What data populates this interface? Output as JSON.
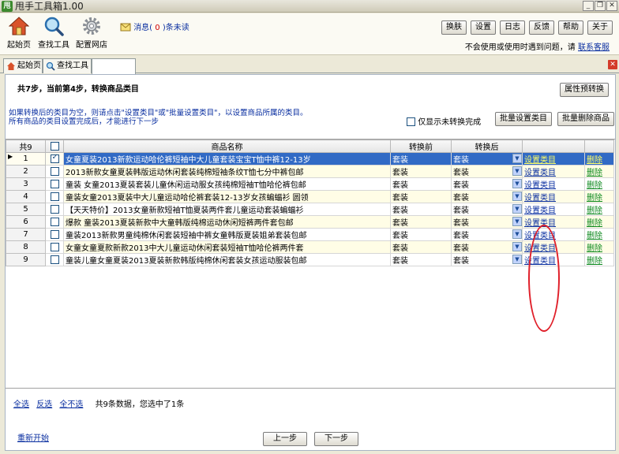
{
  "window": {
    "title": "甩手工具箱1.00",
    "icon_text": "甩",
    "minimize": "_",
    "restore": "❐",
    "close": "✕"
  },
  "toolbar": {
    "tools": [
      {
        "label": "起始页",
        "icon": "home-icon"
      },
      {
        "label": "查找工具",
        "icon": "magnifier-icon"
      },
      {
        "label": "配置网店",
        "icon": "gear-icon"
      }
    ],
    "message": {
      "prefix": "消息(",
      "count": "0",
      "suffix": ")条未读"
    },
    "buttons": [
      "换肤",
      "设置",
      "日志",
      "反馈",
      "帮助",
      "关于"
    ],
    "help_text": "不会使用或使用时遇到问题，请",
    "help_link": "联系客服"
  },
  "tabs": [
    {
      "label": "起始页",
      "icon": "home-icon"
    },
    {
      "label": "查找工具",
      "icon": "magnifier-icon"
    },
    {
      "label": "",
      "icon": ""
    }
  ],
  "tab_close": "✕",
  "step": {
    "title": "共7步，当前第4步，转换商品类目",
    "property_button": "属性预转换",
    "note_line1": "如果转换后的类目为空，则请点击\"设置类目\"或\"批量设置类目\"，以设置商品所属的类目。",
    "note_line2": "所有商品的类目设置完成后，才能进行下一步",
    "only_unconverted_label": "仅显示未转换完成",
    "batch_set_button": "批量设置类目",
    "batch_delete_button": "批量删除商品"
  },
  "grid": {
    "count_header": "共9",
    "columns": {
      "name": "商品名称",
      "before": "转换前",
      "after": "转换后"
    },
    "rows": [
      {
        "num": "1",
        "checked": true,
        "name": "女童夏装2013新款运动哈伦裤短袖中大儿童套装宝宝T恤中裤12-13岁",
        "before": "套装",
        "after": "套装",
        "action": "设置类目",
        "delete": "删除"
      },
      {
        "num": "2",
        "checked": false,
        "name": "2013新款女童夏装韩版运动休闲套装纯棉短袖条纹T恤七分中裤包邮",
        "before": "套装",
        "after": "套装",
        "action": "设置类目",
        "delete": "删除"
      },
      {
        "num": "3",
        "checked": false,
        "name": "童装 女童2013夏装套装儿童休闲运动服女孩纯棉短袖T恤哈伦裤包邮",
        "before": "套装",
        "after": "套装",
        "action": "设置类目",
        "delete": "删除"
      },
      {
        "num": "4",
        "checked": false,
        "name": "童装女童2013夏装中大儿童运动哈伦裤套装12-13岁女孩蝙蝠衫 圆领",
        "before": "套装",
        "after": "套装",
        "action": "设置类目",
        "delete": "删除"
      },
      {
        "num": "5",
        "checked": false,
        "name": "【天天特价】2013女童新款短袖T恤夏装两件套儿童运动套装蝙蝠衫",
        "before": "套装",
        "after": "套装",
        "action": "设置类目",
        "delete": "删除"
      },
      {
        "num": "6",
        "checked": false,
        "name": "爆款 童装2013夏装新款中大童韩版纯棉运动休闲短裤两件套包邮",
        "before": "套装",
        "after": "套装",
        "action": "设置类目",
        "delete": "删除"
      },
      {
        "num": "7",
        "checked": false,
        "name": "童装2013新款男童纯棉休闲套装短袖中裤女童韩版夏装姐弟套装包邮",
        "before": "套装",
        "after": "套装",
        "action": "设置类目",
        "delete": "删除"
      },
      {
        "num": "8",
        "checked": false,
        "name": "女童女童夏款新款2013中大儿童运动休闲套装短袖T恤哈伦裤两件套",
        "before": "套装",
        "after": "套装",
        "action": "设置类目",
        "delete": "删除"
      },
      {
        "num": "9",
        "checked": false,
        "name": "童装儿童女童夏装2013夏装新款韩版纯棉休闲套装女孩运动服装包邮",
        "before": "套装",
        "after": "套装",
        "action": "设置类目",
        "delete": "删除"
      }
    ]
  },
  "footer": {
    "select_all": "全选",
    "invert": "反选",
    "select_none": "全不选",
    "summary": "共9条数据，您选中了1条",
    "restart": "重新开始",
    "prev": "上一步",
    "next": "下一步"
  }
}
